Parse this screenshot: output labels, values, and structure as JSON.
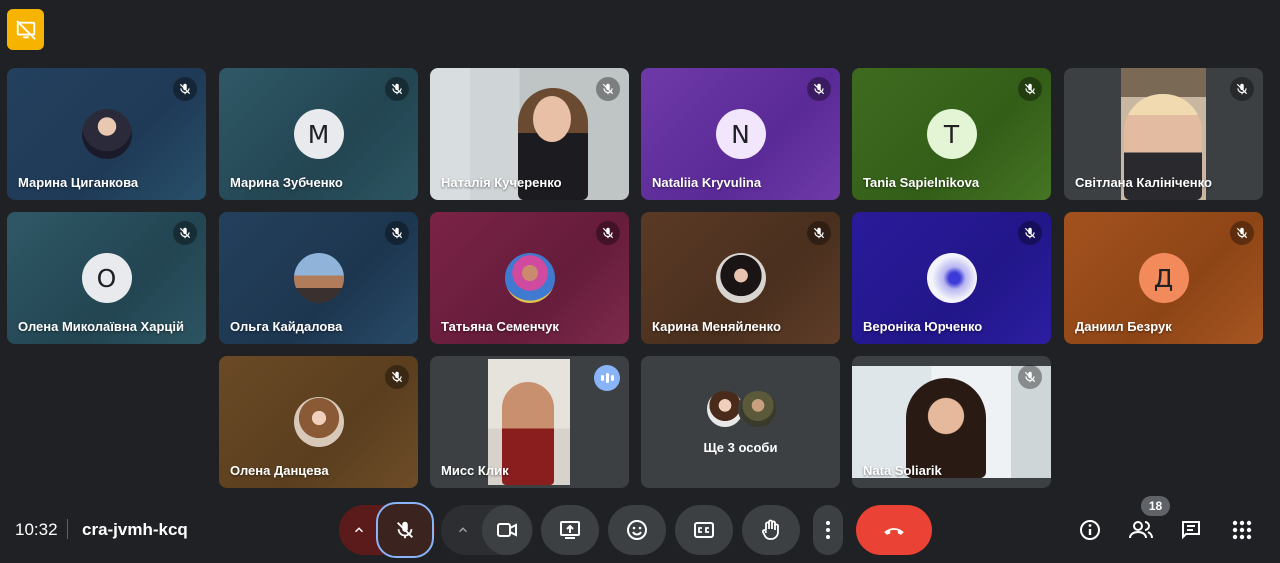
{
  "colors": {
    "background": "#202124",
    "accent": "#8ab4f8",
    "end_call": "#ea4335",
    "badge": "#f6b400"
  },
  "participants": [
    {
      "name": "Марина Циганкова",
      "avatar_type": "photo",
      "muted": true
    },
    {
      "name": "Марина Зубченко",
      "avatar_type": "initial",
      "initial": "М",
      "muted": true
    },
    {
      "name": "Наталія Кучеренко",
      "avatar_type": "video",
      "muted": true
    },
    {
      "name": "Nataliia Kryvulina",
      "avatar_type": "initial",
      "initial": "N",
      "muted": true
    },
    {
      "name": "Tania Sapielnikova",
      "avatar_type": "initial",
      "initial": "T",
      "muted": true
    },
    {
      "name": "Світлана Калініченко",
      "avatar_type": "video",
      "muted": true
    },
    {
      "name": "Олена Миколаївна Харцій",
      "avatar_type": "initial",
      "initial": "О",
      "muted": true
    },
    {
      "name": "Ольга Кайдалова",
      "avatar_type": "photo",
      "muted": true
    },
    {
      "name": "Татьяна Семенчук",
      "avatar_type": "photo",
      "muted": true
    },
    {
      "name": "Карина Меняйленко",
      "avatar_type": "photo",
      "muted": true
    },
    {
      "name": "Вероніка Юрченко",
      "avatar_type": "photo",
      "muted": true
    },
    {
      "name": "Даниил Безрук",
      "avatar_type": "initial",
      "initial": "Д",
      "muted": true
    },
    {
      "name": "Олена Данцева",
      "avatar_type": "photo",
      "muted": true
    },
    {
      "name": "Мисс Клик",
      "avatar_type": "video",
      "speaking": true
    },
    {
      "name": "Ще 3 особи",
      "avatar_type": "group"
    },
    {
      "name": "Nata Soliarik",
      "avatar_type": "video",
      "muted": true
    }
  ],
  "bottom_bar": {
    "time": "10:32",
    "meeting_code": "cra-jvmh-kcq",
    "participant_count": "18"
  },
  "icons": {
    "top_left": "presentation-off-icon",
    "mic": "mic-off-icon",
    "camera": "videocam-icon",
    "present": "present-screen-icon",
    "reactions": "emoji-icon",
    "captions": "closed-captions-icon",
    "hand": "raise-hand-icon",
    "more": "more-vert-icon",
    "end": "call-end-icon",
    "info": "info-icon",
    "people": "people-icon",
    "chat": "chat-icon",
    "activities": "apps-grid-icon"
  }
}
